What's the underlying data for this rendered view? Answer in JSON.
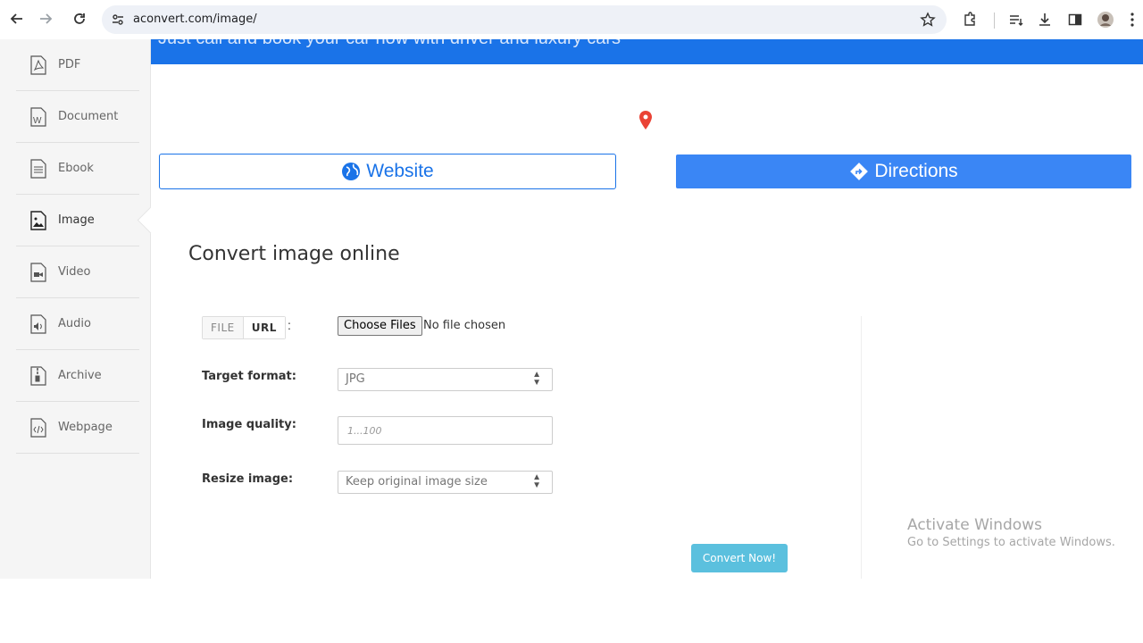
{
  "browser": {
    "url": "aconvert.com/image/"
  },
  "sidebar": {
    "items": [
      {
        "label": "PDF",
        "icon": "pdf-file-icon"
      },
      {
        "label": "Document",
        "icon": "word-file-icon"
      },
      {
        "label": "Ebook",
        "icon": "ebook-file-icon"
      },
      {
        "label": "Image",
        "icon": "image-file-icon",
        "active": true
      },
      {
        "label": "Video",
        "icon": "video-file-icon"
      },
      {
        "label": "Audio",
        "icon": "audio-file-icon"
      },
      {
        "label": "Archive",
        "icon": "archive-file-icon"
      },
      {
        "label": "Webpage",
        "icon": "webpage-file-icon"
      }
    ]
  },
  "ad": {
    "text": "Just call and book your car now with driver and luxury cars",
    "website_label": "Website",
    "directions_label": "Directions",
    "colors": {
      "banner": "#1a73e8",
      "directions": "#3a86f5",
      "pin": "#ea4335"
    }
  },
  "main": {
    "title": "Convert image online",
    "source_tabs": {
      "file": "FILE",
      "url": "URL"
    },
    "choose_files_label": "Choose Files",
    "no_file_text": "No file chosen",
    "target_format_label": "Target format:",
    "target_format_value": "JPG",
    "image_quality_label": "Image quality:",
    "image_quality_placeholder": "1...100",
    "resize_label": "Resize image:",
    "resize_value": "Keep original image size",
    "convert_label": "Convert Now!",
    "convert_color": "#5bc0de"
  },
  "watermark": {
    "title": "Activate Windows",
    "subtitle": "Go to Settings to activate Windows."
  }
}
